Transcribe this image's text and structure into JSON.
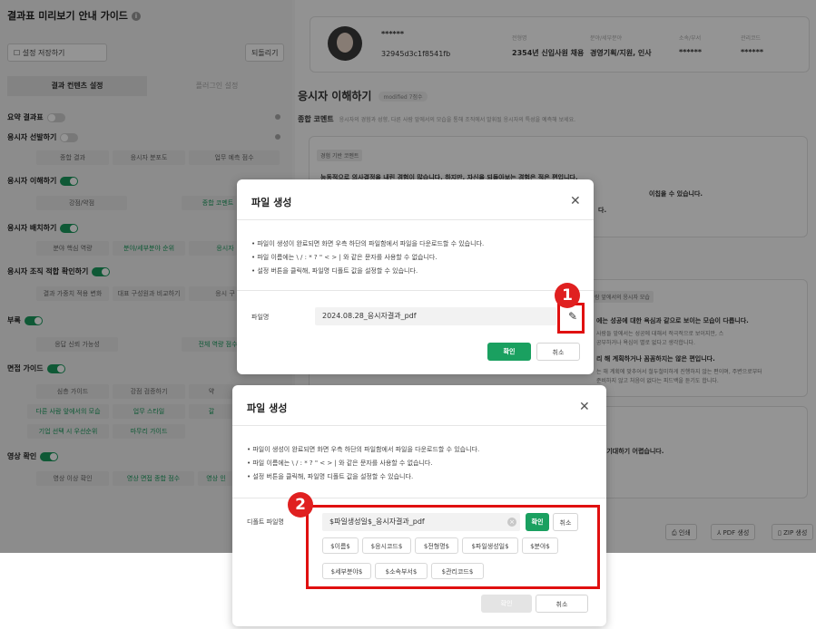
{
  "sidebar": {
    "title": "결과표 미리보기 안내 가이드",
    "save_settings": "설정 저장하기",
    "reset": "되돌리기",
    "tabs": [
      "결과 컨텐츠 설정",
      "플러그인 설정"
    ],
    "sections": [
      {
        "label": "요약 결과표",
        "toggle": "off"
      },
      {
        "label": "응시자 선발하기",
        "toggle": "off"
      },
      {
        "label": "응시자 이해하기",
        "toggle": "on"
      },
      {
        "label": "응시자 배치하기",
        "toggle": "on"
      },
      {
        "label": "응시자 조직 적합 확인하기",
        "toggle": "on"
      },
      {
        "label": "부록",
        "toggle": "on"
      },
      {
        "label": "면접 가이드",
        "toggle": "on"
      },
      {
        "label": "영상 확인",
        "toggle": "on"
      }
    ],
    "chips": {
      "select": [
        "종합 결과",
        "응시자 분포도",
        "업무 예측 점수"
      ],
      "understand": [
        "강점/약점",
        "종합 코멘트"
      ],
      "deploy": [
        "분야 핵심 역량",
        "분야/세부분야 순위",
        "응시자"
      ],
      "fit": [
        "결과 가중치 적용 변화",
        "대표 구성원과 비교하기",
        "응시 구"
      ],
      "appendix": [
        "응답 신뢰 가능성",
        "전체 역량 점수"
      ],
      "interview": [
        "심층 가이드",
        "강점 검증하기",
        "약"
      ],
      "interview2": [
        "다른 사람 앞에서의 모습",
        "업무 스타일",
        "갈"
      ],
      "interview3": [
        "기업 선택 시 우선순위",
        "마무리 가이드"
      ],
      "video": [
        "영상 이상 확인",
        "영상 면접 종합 점수",
        "영상 인"
      ]
    }
  },
  "profile": {
    "name": "******",
    "code": "32945d3c1f8541fb",
    "labels": [
      "전형명",
      "분야/세부분야",
      "소속/부서",
      "관리코드"
    ],
    "values": [
      "2354년 신입사원 채용",
      "경영기획/지원, 인사",
      "******",
      "******"
    ]
  },
  "main": {
    "heading": "응시자 이해하기",
    "heading_pill": "modified 7점수",
    "sub_heading": "종합 코멘트",
    "sub_desc": "응시자의 경험과 성향, 다른 사람 앞에서의 모습을 통해 조직에서 발휘될 응시자의 특성을 예측해 보세요.",
    "card1_tag": "경험 기반 코멘트",
    "card1_line1": "능동적으로 의사결정을 내린 경험이 많습니다. 하지만, 자신을 되돌아보는 경험은 적은 편입니다.",
    "card1_line2": "이칩을 수 있습니다.",
    "card1_line3": "다.",
    "card2_tag": "람 앞에서의 응시자 모습",
    "card2_line1": "에는 성공에 대한 욕심과 같으로 보이는 모습이 다릅니다.",
    "card2_line2": "사람들 앞에서는 성공에 대해서 적극적으로 보이지만, 스",
    "card2_line3": "공부하거나 욕심이 별로 없다고 생각합니다.",
    "card2_line4": "리 해 계획하거나 꼼꼼하지는 않은 편입니다.",
    "card2_line5": "는 해 계획에 맞추어서 철두철미하게 진행하지 않는 편이며, 주변으로부터",
    "card2_line6": "준비하지 않고 처음이 없다는 피드백을 듣기도 합니다.",
    "card3_line1": "과를 기대하기 어렵습니다.",
    "card3_line2": "다.",
    "footer_buttons": [
      "인쇄",
      "PDF 생성",
      "ZIP 생성"
    ]
  },
  "dialog1": {
    "title": "파일 생성",
    "notices": [
      "• 파일이 생성이 완료되면 화면 우측 하단의 파일함에서 파일을 다운로드할 수 있습니다.",
      "• 파일 이름에는 \\ / : * ? \" < > | 와 같은 문자를 사용할 수 없습니다.",
      "• 설정 버튼을 클릭해, 파일명 디폴트 값을 설정할 수 있습니다."
    ],
    "field_label": "파일명",
    "field_value": "2024.08.28_응시자결과_pdf",
    "confirm": "확인",
    "cancel": "취소"
  },
  "dialog2": {
    "title": "파일 생성",
    "notices": [
      "• 파일이 생성이 완료되면 화면 우측 하단의 파일함에서 파일을 다운로드할 수 있습니다.",
      "• 파일 이름에는 \\ / : * ? \" < > | 와 같은 문자를 사용할 수 없습니다.",
      "• 설정 버튼을 클릭해, 파일명 디폴트 값을 설정할 수 있습니다."
    ],
    "field_label": "디폴트 파일명",
    "field_value": "$파일생성일$_응시자결과_pdf",
    "inline_confirm": "확인",
    "inline_cancel": "취소",
    "variables": [
      "$이름$",
      "$응시코드$",
      "$전형명$",
      "$파일생성일$",
      "$분야$",
      "$세부분야$",
      "$소속부서$",
      "$관리코드$"
    ],
    "confirm": "확인",
    "cancel": "취소"
  },
  "markers": [
    "1",
    "2"
  ],
  "colors": {
    "accent": "#1aa060",
    "highlight": "#e01010"
  }
}
